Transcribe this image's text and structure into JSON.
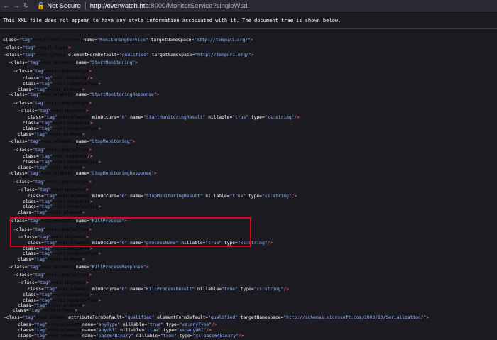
{
  "browser": {
    "security_label": "Not Secure",
    "url_host": "http://overwatch.htb",
    "url_rest": ":8000/MonitorService?singleWsdl"
  },
  "info_text": "This XML file does not appear to have any style information associated with it. The document tree is shown below.",
  "xml_lines": [
    {
      "text": "<wsdl:definitions name=\"MonitoringService\" targetNamespace=\"http://tempuri.org/\">"
    },
    {
      "text": "<wsdl:types>"
    },
    {
      "text": "<xs:schema elementFormDefault=\"qualified\" targetNamespace=\"http://tempuri.org/\">"
    },
    {
      "text": "<xs:element name=\"StartMonitoring\">"
    },
    {
      "text": "<xs:complexType>"
    },
    {
      "text": "<xs:sequence/>"
    },
    {
      "text": "</xs:complexType>"
    },
    {
      "text": "</xs:element>"
    },
    {
      "text": "<xs:element name=\"StartMonitoringResponse\">"
    },
    {
      "text": "<xs:complexType>"
    },
    {
      "text": "<xs:sequence>"
    },
    {
      "text": "<xs:element minOccurs=\"0\" name=\"StartMonitoringResult\" nillable=\"true\" type=\"xs:string\"/>"
    },
    {
      "text": "</xs:sequence>"
    },
    {
      "text": "</xs:complexType>"
    },
    {
      "text": "</xs:element>"
    },
    {
      "text": "<xs:element name=\"StopMonitoring\">"
    },
    {
      "text": "<xs:complexType>"
    },
    {
      "text": "<xs:sequence/>"
    },
    {
      "text": "</xs:complexType>"
    },
    {
      "text": "</xs:element>"
    },
    {
      "text": "<xs:element name=\"StopMonitoringResponse\">"
    },
    {
      "text": "<xs:complexType>"
    },
    {
      "text": "<xs:sequence>"
    },
    {
      "text": "<xs:element minOccurs=\"0\" name=\"StopMonitoringResult\" nillable=\"true\" type=\"xs:string\"/>"
    },
    {
      "text": "</xs:sequence>"
    },
    {
      "text": "</xs:complexType>"
    },
    {
      "text": "</xs:element>"
    },
    {
      "text": "<xs:element name=\"KillProcess\">"
    },
    {
      "text": "<xs:complexType>"
    },
    {
      "text": "<xs:sequence>"
    },
    {
      "text": "<xs:element minOccurs=\"0\" name=\"processName\" nillable=\"true\" type=\"xs:string\"/>"
    },
    {
      "text": "</xs:sequence>"
    },
    {
      "text": "</xs:complexType>"
    },
    {
      "text": "</xs:element>"
    },
    {
      "text": "<xs:element name=\"KillProcessResponse\">"
    },
    {
      "text": "<xs:complexType>"
    },
    {
      "text": "<xs:sequence>"
    },
    {
      "text": "<xs:element minOccurs=\"0\" name=\"KillProcessResult\" nillable=\"true\" type=\"xs:string\"/>"
    },
    {
      "text": "</xs:sequence>"
    },
    {
      "text": "</xs:complexType>"
    },
    {
      "text": "</xs:element>"
    },
    {
      "text": "</xs:schema>"
    },
    {
      "text": "<xs:schema attributeFormDefault=\"qualified\" elementFormDefault=\"qualified\" targetNamespace=\"http://schemas.microsoft.com/2003/10/Serialization/\">"
    },
    {
      "text": "<xs:element name=\"anyType\" nillable=\"true\" type=\"xs:anyType\"/>"
    },
    {
      "text": "<xs:element name=\"anyURI\" nillable=\"true\" type=\"xs:anyURI\"/>"
    },
    {
      "text": "<xs:element name=\"base64Binary\" nillable=\"true\" type=\"xs:base64Binary\"/>"
    }
  ]
}
